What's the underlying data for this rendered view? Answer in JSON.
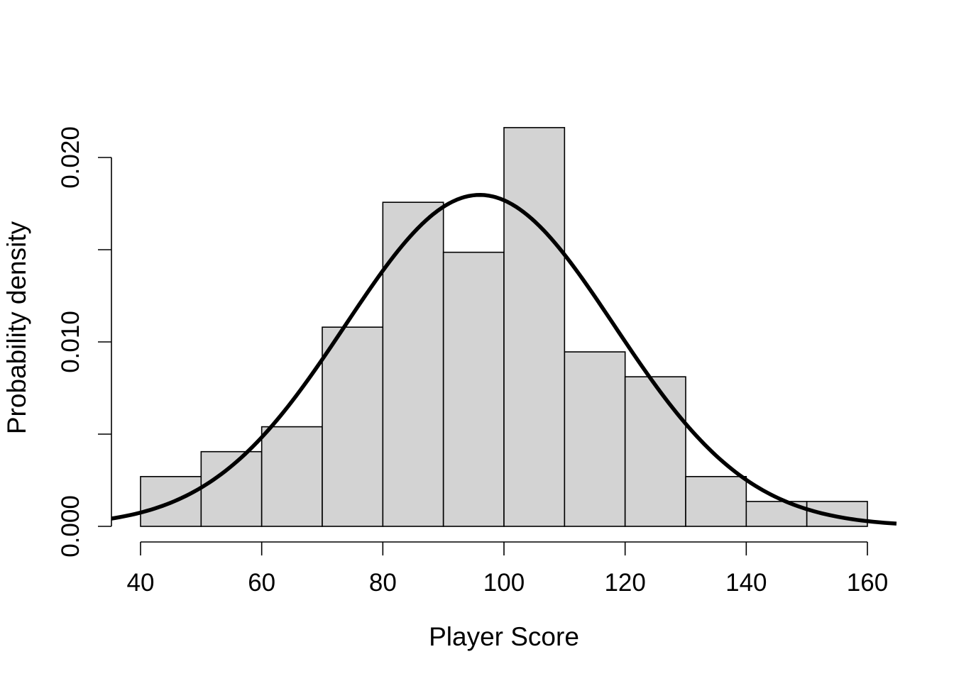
{
  "chart_data": {
    "type": "bar",
    "subtype": "histogram-with-density-curve",
    "title": "",
    "xlabel": "Player Score",
    "ylabel": "Probability density",
    "xlim": [
      35.2,
      164.8
    ],
    "ylim": [
      0,
      0.0225
    ],
    "grid": false,
    "legend": "none",
    "x_ticks": [
      40,
      60,
      80,
      100,
      120,
      140,
      160
    ],
    "x_tick_labels": [
      "40",
      "60",
      "80",
      "100",
      "120",
      "140",
      "160"
    ],
    "y_ticks": [
      0,
      0.005,
      0.01,
      0.015,
      0.02
    ],
    "y_tick_labels": [
      "0.000",
      "",
      "0.010",
      "",
      "0.020"
    ],
    "bins": [
      {
        "from": 40,
        "to": 50,
        "count": 2,
        "density": 0.0027
      },
      {
        "from": 50,
        "to": 60,
        "count": 3,
        "density": 0.00405
      },
      {
        "from": 60,
        "to": 70,
        "count": 4,
        "density": 0.0054
      },
      {
        "from": 70,
        "to": 80,
        "count": 8,
        "density": 0.0108
      },
      {
        "from": 80,
        "to": 90,
        "count": 13,
        "density": 0.01757
      },
      {
        "from": 90,
        "to": 100,
        "count": 11,
        "density": 0.01486
      },
      {
        "from": 100,
        "to": 110,
        "count": 16,
        "density": 0.02162
      },
      {
        "from": 110,
        "to": 120,
        "count": 7,
        "density": 0.00946
      },
      {
        "from": 120,
        "to": 130,
        "count": 6,
        "density": 0.00811
      },
      {
        "from": 130,
        "to": 140,
        "count": 2,
        "density": 0.0027
      },
      {
        "from": 140,
        "to": 150,
        "count": 1,
        "density": 0.00135
      },
      {
        "from": 150,
        "to": 160,
        "count": 1,
        "density": 0.00135
      }
    ],
    "series": [
      {
        "name": "histogram",
        "type": "bar",
        "fill": "#d3d3d3",
        "stroke": "#000000"
      },
      {
        "name": "normal density curve",
        "type": "line",
        "distribution": "normal",
        "mean": 96,
        "sd": 22.2,
        "x_range": [
          35.2,
          164.8
        ],
        "color": "#000000"
      }
    ]
  }
}
